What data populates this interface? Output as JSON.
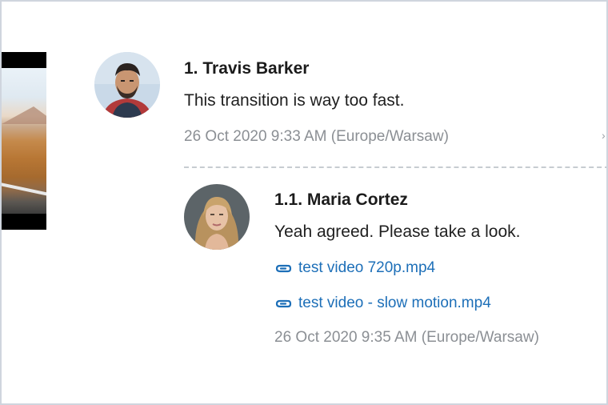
{
  "comments": [
    {
      "author": "1. Travis Barker",
      "text": "This transition is way too fast.",
      "timestamp": "26 Oct 2020 9:33 AM (Europe/Warsaw)"
    }
  ],
  "reply": {
    "author": "1.1. Maria Cortez",
    "text": "Yeah agreed. Please take a look.",
    "attachments": [
      {
        "name": "test video 720p.mp4",
        "icon": "paperclip-icon"
      },
      {
        "name": "test video - slow motion.mp4",
        "icon": "paperclip-icon"
      }
    ],
    "timestamp": "26 Oct 2020 9:35 AM (Europe/Warsaw)"
  },
  "colors": {
    "link": "#1d6fb8",
    "timestamp": "#8b8f94",
    "author": "#1b1b1b"
  }
}
